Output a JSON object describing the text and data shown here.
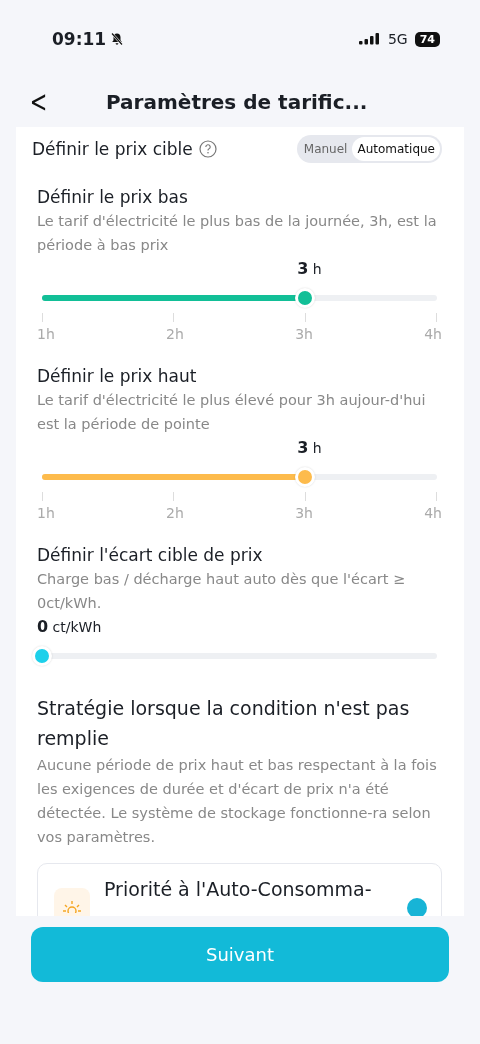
{
  "status_bar": {
    "time": "09:11",
    "network": "5G",
    "battery": "74"
  },
  "header": {
    "back": "<",
    "title": "Paramètres de tarific..."
  },
  "target": {
    "label": "Définir le prix cible",
    "mode_options": [
      {
        "label": "Manuel",
        "selected": false
      },
      {
        "label": "Automatique",
        "selected": true
      }
    ]
  },
  "sections": [
    {
      "kind": "ticks",
      "title": "Définir le prix bas",
      "description": "Le tarif d'électricité le plus bas de la journée, 3h, est la période à bas prix",
      "value": "3",
      "unit": "h",
      "level": 0.667,
      "color": "#12bf97",
      "ticks": [
        "1h",
        "2h",
        "3h",
        "4h"
      ]
    },
    {
      "kind": "ticks",
      "title": "Définir le prix haut",
      "description": "Le tarif d'électricité le plus élevé pour 3h aujour-d'hui est la période de pointe",
      "value": "3",
      "unit": "h",
      "level": 0.667,
      "color": "#fdbb4c",
      "ticks": [
        "1h",
        "2h",
        "3h",
        "4h"
      ]
    },
    {
      "kind": "plain",
      "title": "Définir l'écart cible de prix",
      "description": "Charge bas / décharge haut auto dès que l'écart ≥ 0ct/kWh.",
      "value": "0",
      "unit": "ct/kWh",
      "level": 0,
      "color": "#1dd0ea"
    }
  ],
  "strategy": {
    "title": "Stratégie lorsque la condition n'est pas remplie",
    "description": "Aucune période de prix haut et bas respectant à la fois les exigences de durée et d'écart de prix n'a été détectée. Le système de stockage fonctionne-ra selon vos paramètres.",
    "options": [
      {
        "label": "Priorité à l'Auto-Consomma-",
        "selected": true
      }
    ]
  },
  "next_button": "Suivant"
}
